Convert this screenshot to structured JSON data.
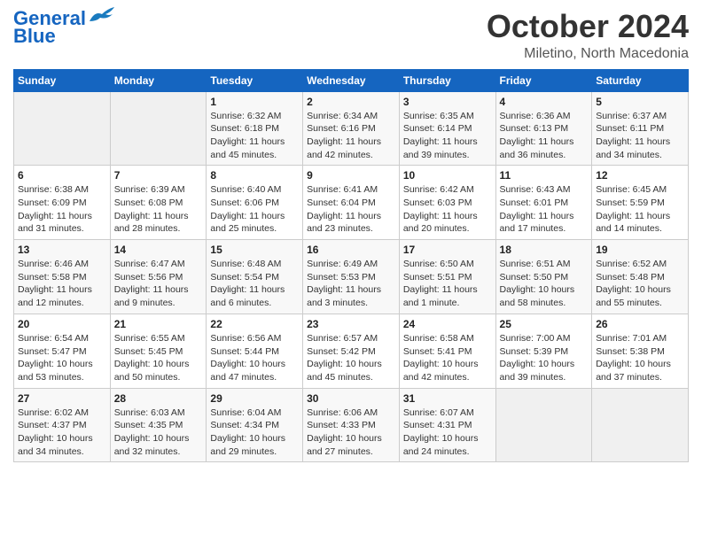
{
  "header": {
    "logo_line1": "General",
    "logo_line2": "Blue",
    "month": "October 2024",
    "location": "Miletino, North Macedonia"
  },
  "days_of_week": [
    "Sunday",
    "Monday",
    "Tuesday",
    "Wednesday",
    "Thursday",
    "Friday",
    "Saturday"
  ],
  "weeks": [
    [
      {
        "day": "",
        "sunrise": "",
        "sunset": "",
        "daylight": ""
      },
      {
        "day": "",
        "sunrise": "",
        "sunset": "",
        "daylight": ""
      },
      {
        "day": "1",
        "sunrise": "Sunrise: 6:32 AM",
        "sunset": "Sunset: 6:18 PM",
        "daylight": "Daylight: 11 hours and 45 minutes."
      },
      {
        "day": "2",
        "sunrise": "Sunrise: 6:34 AM",
        "sunset": "Sunset: 6:16 PM",
        "daylight": "Daylight: 11 hours and 42 minutes."
      },
      {
        "day": "3",
        "sunrise": "Sunrise: 6:35 AM",
        "sunset": "Sunset: 6:14 PM",
        "daylight": "Daylight: 11 hours and 39 minutes."
      },
      {
        "day": "4",
        "sunrise": "Sunrise: 6:36 AM",
        "sunset": "Sunset: 6:13 PM",
        "daylight": "Daylight: 11 hours and 36 minutes."
      },
      {
        "day": "5",
        "sunrise": "Sunrise: 6:37 AM",
        "sunset": "Sunset: 6:11 PM",
        "daylight": "Daylight: 11 hours and 34 minutes."
      }
    ],
    [
      {
        "day": "6",
        "sunrise": "Sunrise: 6:38 AM",
        "sunset": "Sunset: 6:09 PM",
        "daylight": "Daylight: 11 hours and 31 minutes."
      },
      {
        "day": "7",
        "sunrise": "Sunrise: 6:39 AM",
        "sunset": "Sunset: 6:08 PM",
        "daylight": "Daylight: 11 hours and 28 minutes."
      },
      {
        "day": "8",
        "sunrise": "Sunrise: 6:40 AM",
        "sunset": "Sunset: 6:06 PM",
        "daylight": "Daylight: 11 hours and 25 minutes."
      },
      {
        "day": "9",
        "sunrise": "Sunrise: 6:41 AM",
        "sunset": "Sunset: 6:04 PM",
        "daylight": "Daylight: 11 hours and 23 minutes."
      },
      {
        "day": "10",
        "sunrise": "Sunrise: 6:42 AM",
        "sunset": "Sunset: 6:03 PM",
        "daylight": "Daylight: 11 hours and 20 minutes."
      },
      {
        "day": "11",
        "sunrise": "Sunrise: 6:43 AM",
        "sunset": "Sunset: 6:01 PM",
        "daylight": "Daylight: 11 hours and 17 minutes."
      },
      {
        "day": "12",
        "sunrise": "Sunrise: 6:45 AM",
        "sunset": "Sunset: 5:59 PM",
        "daylight": "Daylight: 11 hours and 14 minutes."
      }
    ],
    [
      {
        "day": "13",
        "sunrise": "Sunrise: 6:46 AM",
        "sunset": "Sunset: 5:58 PM",
        "daylight": "Daylight: 11 hours and 12 minutes."
      },
      {
        "day": "14",
        "sunrise": "Sunrise: 6:47 AM",
        "sunset": "Sunset: 5:56 PM",
        "daylight": "Daylight: 11 hours and 9 minutes."
      },
      {
        "day": "15",
        "sunrise": "Sunrise: 6:48 AM",
        "sunset": "Sunset: 5:54 PM",
        "daylight": "Daylight: 11 hours and 6 minutes."
      },
      {
        "day": "16",
        "sunrise": "Sunrise: 6:49 AM",
        "sunset": "Sunset: 5:53 PM",
        "daylight": "Daylight: 11 hours and 3 minutes."
      },
      {
        "day": "17",
        "sunrise": "Sunrise: 6:50 AM",
        "sunset": "Sunset: 5:51 PM",
        "daylight": "Daylight: 11 hours and 1 minute."
      },
      {
        "day": "18",
        "sunrise": "Sunrise: 6:51 AM",
        "sunset": "Sunset: 5:50 PM",
        "daylight": "Daylight: 10 hours and 58 minutes."
      },
      {
        "day": "19",
        "sunrise": "Sunrise: 6:52 AM",
        "sunset": "Sunset: 5:48 PM",
        "daylight": "Daylight: 10 hours and 55 minutes."
      }
    ],
    [
      {
        "day": "20",
        "sunrise": "Sunrise: 6:54 AM",
        "sunset": "Sunset: 5:47 PM",
        "daylight": "Daylight: 10 hours and 53 minutes."
      },
      {
        "day": "21",
        "sunrise": "Sunrise: 6:55 AM",
        "sunset": "Sunset: 5:45 PM",
        "daylight": "Daylight: 10 hours and 50 minutes."
      },
      {
        "day": "22",
        "sunrise": "Sunrise: 6:56 AM",
        "sunset": "Sunset: 5:44 PM",
        "daylight": "Daylight: 10 hours and 47 minutes."
      },
      {
        "day": "23",
        "sunrise": "Sunrise: 6:57 AM",
        "sunset": "Sunset: 5:42 PM",
        "daylight": "Daylight: 10 hours and 45 minutes."
      },
      {
        "day": "24",
        "sunrise": "Sunrise: 6:58 AM",
        "sunset": "Sunset: 5:41 PM",
        "daylight": "Daylight: 10 hours and 42 minutes."
      },
      {
        "day": "25",
        "sunrise": "Sunrise: 7:00 AM",
        "sunset": "Sunset: 5:39 PM",
        "daylight": "Daylight: 10 hours and 39 minutes."
      },
      {
        "day": "26",
        "sunrise": "Sunrise: 7:01 AM",
        "sunset": "Sunset: 5:38 PM",
        "daylight": "Daylight: 10 hours and 37 minutes."
      }
    ],
    [
      {
        "day": "27",
        "sunrise": "Sunrise: 6:02 AM",
        "sunset": "Sunset: 4:37 PM",
        "daylight": "Daylight: 10 hours and 34 minutes."
      },
      {
        "day": "28",
        "sunrise": "Sunrise: 6:03 AM",
        "sunset": "Sunset: 4:35 PM",
        "daylight": "Daylight: 10 hours and 32 minutes."
      },
      {
        "day": "29",
        "sunrise": "Sunrise: 6:04 AM",
        "sunset": "Sunset: 4:34 PM",
        "daylight": "Daylight: 10 hours and 29 minutes."
      },
      {
        "day": "30",
        "sunrise": "Sunrise: 6:06 AM",
        "sunset": "Sunset: 4:33 PM",
        "daylight": "Daylight: 10 hours and 27 minutes."
      },
      {
        "day": "31",
        "sunrise": "Sunrise: 6:07 AM",
        "sunset": "Sunset: 4:31 PM",
        "daylight": "Daylight: 10 hours and 24 minutes."
      },
      {
        "day": "",
        "sunrise": "",
        "sunset": "",
        "daylight": ""
      },
      {
        "day": "",
        "sunrise": "",
        "sunset": "",
        "daylight": ""
      }
    ]
  ]
}
